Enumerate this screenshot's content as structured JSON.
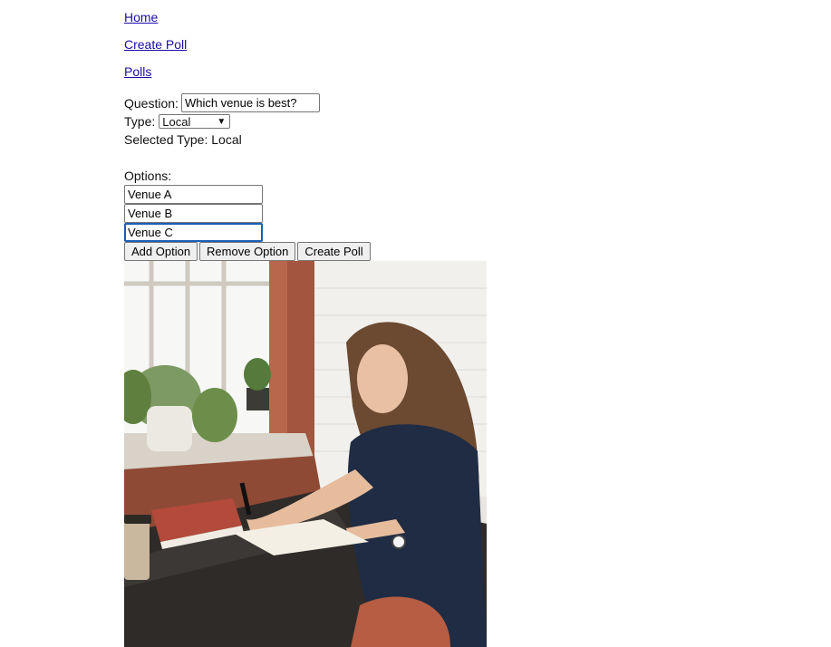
{
  "nav": {
    "home": "Home",
    "create_poll": "Create Poll",
    "polls": "Polls"
  },
  "form": {
    "question_label": "Question:",
    "question_value": "Which venue is best?",
    "type_label": "Type:",
    "type_selected": "Local",
    "selected_type_text": "Selected Type: Local",
    "options_label": "Options:",
    "options": [
      "Venue A",
      "Venue B",
      "Venue C"
    ],
    "add_option": "Add Option",
    "remove_option": "Remove Option",
    "create_poll": "Create Poll"
  },
  "image": {
    "subject": "woman-writing-in-notebook-photo"
  },
  "colors": {
    "link": "#1a0dab",
    "focus": "#1a5fb4"
  }
}
